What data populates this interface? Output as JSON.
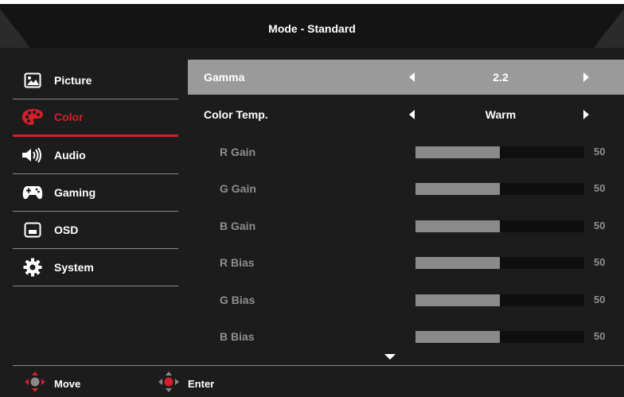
{
  "header": {
    "title": "Mode - Standard"
  },
  "sidebar": {
    "items": [
      {
        "label": "Picture",
        "icon": "picture-icon",
        "active": false
      },
      {
        "label": "Color",
        "icon": "palette-icon",
        "active": true
      },
      {
        "label": "Audio",
        "icon": "speaker-icon",
        "active": false
      },
      {
        "label": "Gaming",
        "icon": "gamepad-icon",
        "active": false
      },
      {
        "label": "OSD",
        "icon": "osd-window-icon",
        "active": false
      },
      {
        "label": "System",
        "icon": "gear-icon",
        "active": false
      }
    ]
  },
  "settings": {
    "gamma": {
      "label": "Gamma",
      "value": "2.2"
    },
    "color_temp": {
      "label": "Color Temp.",
      "value": "Warm"
    },
    "sliders": [
      {
        "label": "R Gain",
        "value": "50",
        "fraction": 0.5
      },
      {
        "label": "G Gain",
        "value": "50",
        "fraction": 0.5
      },
      {
        "label": "B Gain",
        "value": "50",
        "fraction": 0.5
      },
      {
        "label": "R Bias",
        "value": "50",
        "fraction": 0.5
      },
      {
        "label": "G Bias",
        "value": "50",
        "fraction": 0.5
      },
      {
        "label": "B Bias",
        "value": "50",
        "fraction": 0.5
      }
    ]
  },
  "footer": {
    "move_label": "Move",
    "enter_label": "Enter"
  },
  "colors": {
    "accent": "#d61f2a",
    "highlight": "#9a9a9a",
    "background": "#1c1c1c",
    "dim_text": "#8e8e8e"
  }
}
